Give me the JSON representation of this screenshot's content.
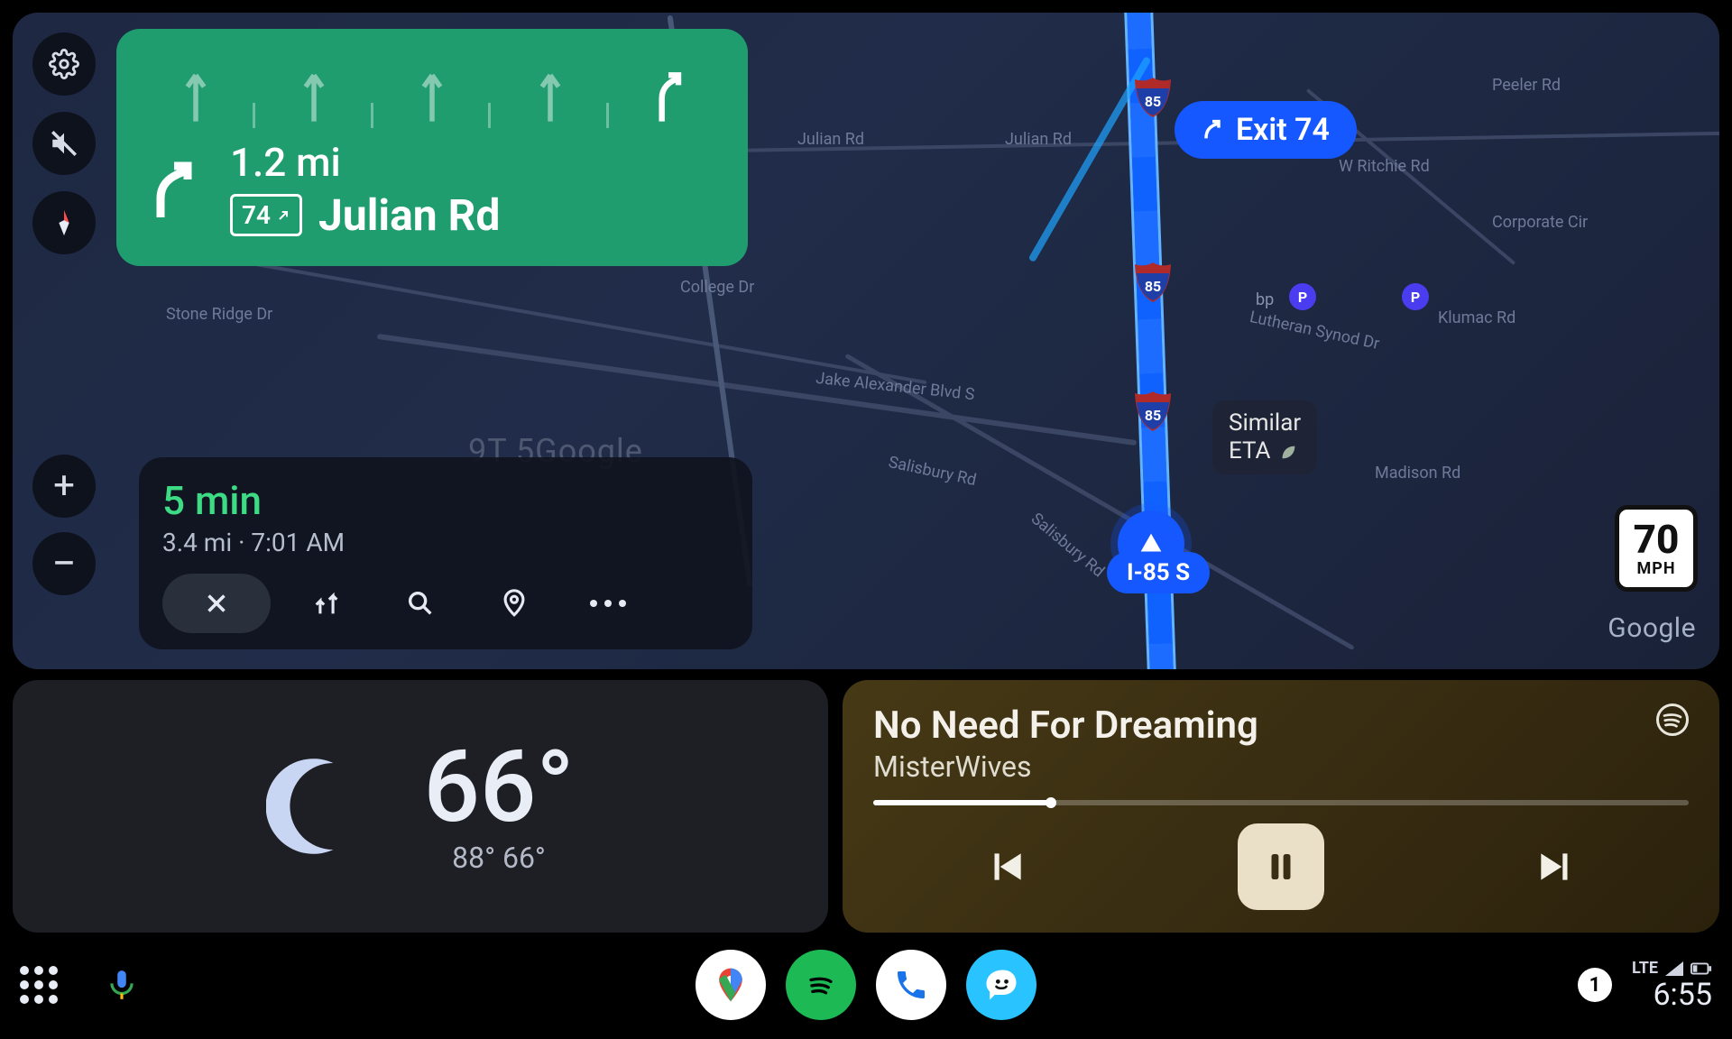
{
  "map": {
    "exit_label": "Exit 74",
    "current_route": "I-85 S",
    "speed_limit": {
      "value": "70",
      "unit": "MPH"
    },
    "similar_eta": {
      "line1": "Similar",
      "line2": "ETA"
    },
    "attribution": "Google",
    "watermark": "9T   5Google",
    "roads": {
      "julian_rd": "Julian Rd",
      "stone_ridge": "Stone Ridge Dr",
      "college_dr": "College Dr",
      "salisbury_rd": "Salisbury Rd",
      "salisbury_rd2": "Salisbury Rd",
      "jake_alex": "Jake Alexander Blvd S",
      "lutheran": "Lutheran Synod Dr",
      "klumac": "Klumac Rd",
      "madison": "Madison Rd",
      "corporate": "Corporate Cir",
      "ritchie": "W Ritchie Rd",
      "peeler": "Peeler Rd"
    },
    "poi": {
      "bp": "bp"
    },
    "buttons": {
      "settings": "settings-icon",
      "mute": "mute-icon",
      "compass": "compass-icon",
      "zoom_in": "+",
      "zoom_out": "−"
    }
  },
  "direction_card": {
    "distance": "1.2 mi",
    "exit_number": "74",
    "road": "Julian Rd"
  },
  "eta_card": {
    "time": "5 min",
    "distance": "3.4 mi",
    "arrival": "7:01 AM"
  },
  "weather": {
    "current": "66°",
    "high": "88°",
    "low": "66°"
  },
  "music": {
    "title": "No Need For Dreaming",
    "artist": "MisterWives",
    "progress_pct": 22
  },
  "dock": {
    "notification_count": "1",
    "network": "LTE",
    "clock": "6:55"
  }
}
